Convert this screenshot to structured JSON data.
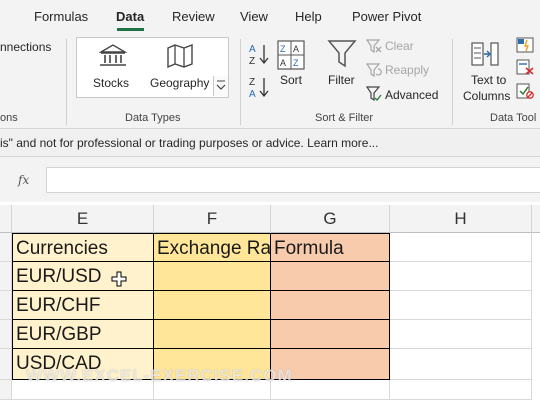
{
  "ribbon": {
    "tabs": [
      "Formulas",
      "Data",
      "Review",
      "View",
      "Help",
      "Power Pivot"
    ],
    "active_tab": "Data",
    "connections_label": "nnections",
    "connections_group_label": "ons",
    "data_types": {
      "stocks_label": "Stocks",
      "geography_label": "Geography",
      "group_label": "Data Types"
    },
    "sort_filter": {
      "sort_az_label": "A Z",
      "sort_za_label": "Z A",
      "sort_label": "Sort",
      "filter_label": "Filter",
      "clear_label": "Clear",
      "reapply_label": "Reapply",
      "advanced_label": "Advanced",
      "group_label": "Sort & Filter"
    },
    "data_tools": {
      "text_to_columns_line1": "Text to",
      "text_to_columns_line2": "Columns",
      "group_label": "Data Tool"
    }
  },
  "infobar": {
    "message": "is\" and not for professional or trading purposes or advice. Learn more..."
  },
  "formula_bar": {
    "fx_label": "fx",
    "value": ""
  },
  "grid": {
    "columns": [
      "E",
      "F",
      "G",
      "H"
    ],
    "headers": {
      "E": "Currencies",
      "F": "Exchange Ra",
      "G": "Formula"
    },
    "rows": [
      "EUR/USD",
      "EUR/CHF",
      "EUR/GBP",
      "USD/CAD"
    ]
  },
  "watermark": "WWW.EXCEL-EXERCISE.COM",
  "colors": {
    "accent": "#217346",
    "currencies_fill": "#fff2cc",
    "rate_fill": "#ffe699",
    "formula_fill": "#f8cbad"
  }
}
